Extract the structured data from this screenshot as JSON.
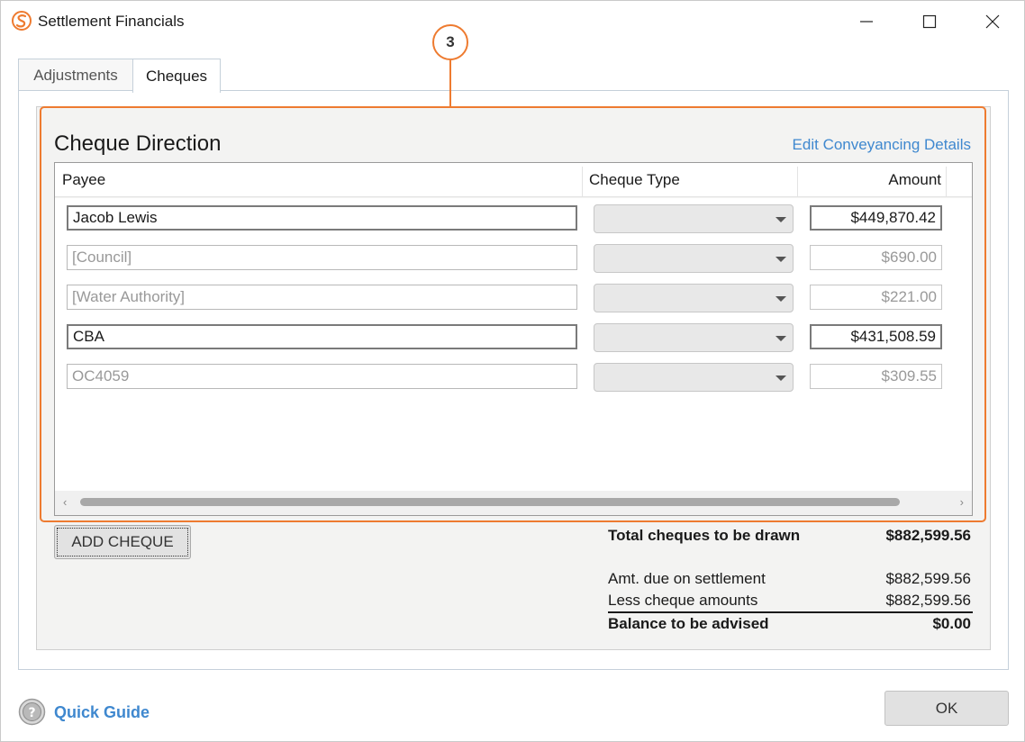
{
  "window": {
    "title": "Settlement Financials",
    "controls": {
      "minimize": "minimize",
      "maximize": "maximize",
      "close": "close"
    }
  },
  "annotation": {
    "callout_number": "3",
    "accent_color": "#ee7b30"
  },
  "tabs": [
    {
      "label": "Adjustments",
      "active": false
    },
    {
      "label": "Cheques",
      "active": true
    }
  ],
  "cheque_direction": {
    "title": "Cheque Direction",
    "edit_link": "Edit Conveyancing Details",
    "columns": {
      "payee": "Payee",
      "cheque_type": "Cheque Type",
      "amount": "Amount"
    },
    "rows": [
      {
        "payee": "Jacob Lewis",
        "cheque_type": "",
        "amount": "$449,870.42",
        "enabled": true
      },
      {
        "payee": "[Council]",
        "cheque_type": "",
        "amount": "$690.00",
        "enabled": false
      },
      {
        "payee": "[Water Authority]",
        "cheque_type": "",
        "amount": "$221.00",
        "enabled": false
      },
      {
        "payee": "CBA",
        "cheque_type": "",
        "amount": "$431,508.59",
        "enabled": true
      },
      {
        "payee": "OC4059",
        "cheque_type": "",
        "amount": "$309.55",
        "enabled": false
      }
    ]
  },
  "add_cheque_label": "ADD CHEQUE",
  "totals": {
    "total_cheques_label": "Total cheques to be drawn",
    "total_cheques_value": "$882,599.56",
    "amt_due_label": "Amt. due on settlement",
    "amt_due_value": "$882,599.56",
    "less_cheque_label": "Less cheque amounts",
    "less_cheque_value": "$882,599.56",
    "balance_label": "Balance to be advised",
    "balance_value": "$0.00"
  },
  "footer": {
    "quick_guide_label": "Quick Guide",
    "ok_label": "OK"
  }
}
